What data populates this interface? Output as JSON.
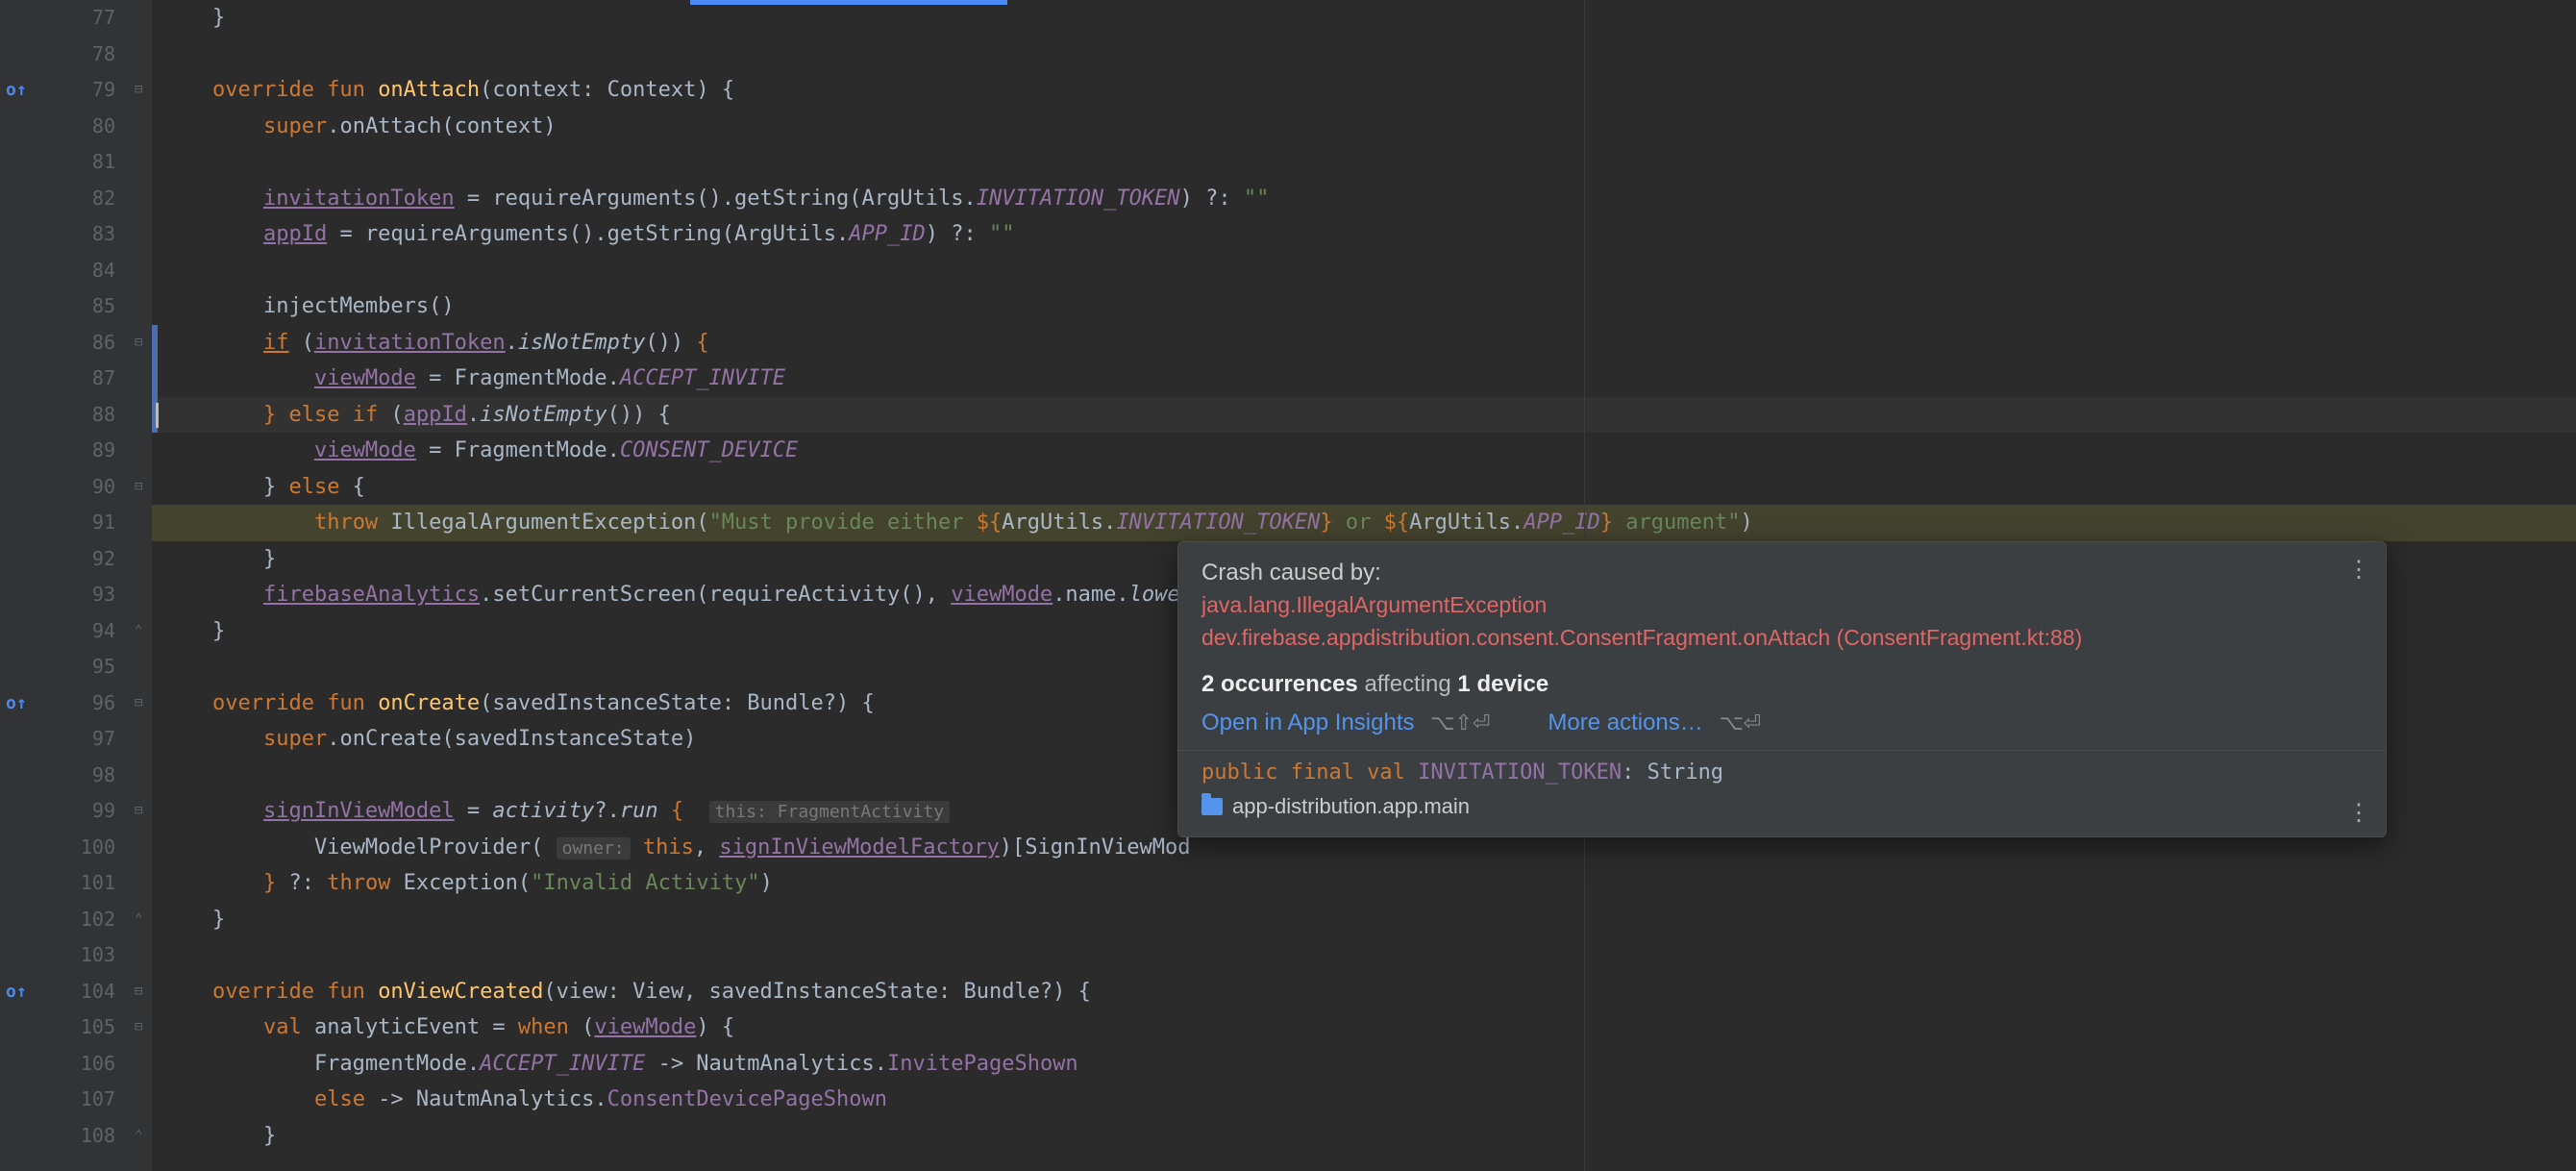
{
  "gutter": {
    "start": 77,
    "end": 108
  },
  "icons": {
    "override": "o↑"
  },
  "code": [
    {
      "n": 77,
      "html": "    }"
    },
    {
      "n": 78,
      "html": ""
    },
    {
      "n": 79,
      "override": true,
      "fold": "−",
      "html": "    <span class='kw'>override fun</span> <span class='fn'>onAttach</span>(context: Context) {"
    },
    {
      "n": 80,
      "html": "        <span class='kw'>super</span>.onAttach(context)"
    },
    {
      "n": 81,
      "html": ""
    },
    {
      "n": 82,
      "html": "        <span class='mut'>invitationToken</span> = requireArguments().getString(ArgUtils.<span class='const'>INVITATION_TOKEN</span>) ?: <span class='str'>\"\"</span>"
    },
    {
      "n": 83,
      "html": "        <span class='mut'>appId</span> = requireArguments().getString(ArgUtils.<span class='const'>APP_ID</span>) ?: <span class='str'>\"\"</span>"
    },
    {
      "n": 84,
      "html": ""
    },
    {
      "n": 85,
      "html": "        injectMembers()"
    },
    {
      "n": 86,
      "fold": "−",
      "cm": true,
      "html": "        <span class='kw ul'>if</span> (<span class='mut'>invitationToken</span>.<span class='italic'>isNotEmpty</span>()) <span class='kw'>{</span>"
    },
    {
      "n": 87,
      "cm": true,
      "html": "            <span class='mut'>viewMode</span> = FragmentMode.<span class='const'>ACCEPT_INVITE</span>"
    },
    {
      "n": 88,
      "current": true,
      "cm": true,
      "caret": true,
      "html": "        <span class='kw'>}</span> <span class='kw'>else if</span> (<span class='mut'>appId</span>.<span class='italic'>isNotEmpty</span>()) {"
    },
    {
      "n": 89,
      "html": "            <span class='mut'>viewMode</span> = FragmentMode.<span class='const'>CONSENT_DEVICE</span>"
    },
    {
      "n": 90,
      "fold": "−",
      "html": "        } <span class='kw'>else</span> {"
    },
    {
      "n": 91,
      "hl": true,
      "html": "            <span class='kw'>throw</span> IllegalArgumentException(<span class='str'>\"Must provide either </span><span class='kw'>${</span>ArgUtils.<span class='const'>INVITATION_TOKEN</span><span class='kw'>}</span><span class='str'> or </span><span class='kw'>${</span>ArgUtils.<span class='const'>APP_ID</span><span class='kw'>}</span><span class='str'> argument\"</span>)"
    },
    {
      "n": 92,
      "html": "        }"
    },
    {
      "n": 93,
      "html": "        <span class='mut'>firebaseAnalytics</span>.setCurrentScreen(requireActivity(), <span class='mut'>viewMode</span>.name.<span class='italic'>lowe</span>"
    },
    {
      "n": 94,
      "fold": "⌃",
      "html": "    }"
    },
    {
      "n": 95,
      "html": ""
    },
    {
      "n": 96,
      "override": true,
      "fold": "−",
      "html": "    <span class='kw'>override fun</span> <span class='fn'>onCreate</span>(savedInstanceState: Bundle?) {"
    },
    {
      "n": 97,
      "html": "        <span class='kw'>super</span>.onCreate(savedInstanceState)"
    },
    {
      "n": 98,
      "html": ""
    },
    {
      "n": 99,
      "fold": "−",
      "html": "        <span class='mut'>signInViewModel</span> = <span class='italic'>activity</span>?.<span class='italic'>run</span> <span class='kw'>{</span>  <span class='hint'>this: FragmentActivity</span>"
    },
    {
      "n": 100,
      "html": "            ViewModelProvider( <span class='hint'>owner:</span> <span class='kw'>this</span>, <span class='mut'>signInViewModelFactory</span>)[SignInViewMod"
    },
    {
      "n": 101,
      "html": "        <span class='kw'>}</span> ?: <span class='kw'>throw</span> Exception(<span class='str'>\"Invalid Activity\"</span>)"
    },
    {
      "n": 102,
      "fold": "⌃",
      "html": "    }"
    },
    {
      "n": 103,
      "html": ""
    },
    {
      "n": 104,
      "override": true,
      "fold": "−",
      "html": "    <span class='kw'>override fun</span> <span class='fn'>onViewCreated</span>(view: View, savedInstanceState: Bundle?) {"
    },
    {
      "n": 105,
      "fold": "−",
      "html": "        <span class='kw'>val</span> analyticEvent = <span class='kw'>when</span> (<span class='mut'>viewMode</span>) {"
    },
    {
      "n": 106,
      "html": "            FragmentMode.<span class='const'>ACCEPT_INVITE</span> -> NautmAnalytics.<span class='const' style='font-style:normal'>InvitePageShown</span>"
    },
    {
      "n": 107,
      "html": "            <span class='kw'>else</span> -> NautmAnalytics.<span class='const' style='font-style:normal'>ConsentDevicePageShown</span>"
    },
    {
      "n": 108,
      "fold": "⌃",
      "html": "        }"
    }
  ],
  "popup": {
    "title": "Crash caused by:",
    "exception": "java.lang.IllegalArgumentException",
    "location": "dev.firebase.appdistribution.consent.ConsentFragment.onAttach (ConsentFragment.kt:88)",
    "occurrences_count": "2",
    "occurrences_label": "occurrences",
    "affecting_label": "affecting",
    "device_count": "1",
    "device_label": "device",
    "open_link": "Open in App Insights",
    "open_shortcut": "⌥⇧⏎",
    "more_link": "More actions…",
    "more_shortcut": "⌥⏎",
    "declaration_kw": "public final val",
    "declaration_name": "INVITATION_TOKEN",
    "declaration_type": ": String",
    "module": "app-distribution.app.main"
  }
}
